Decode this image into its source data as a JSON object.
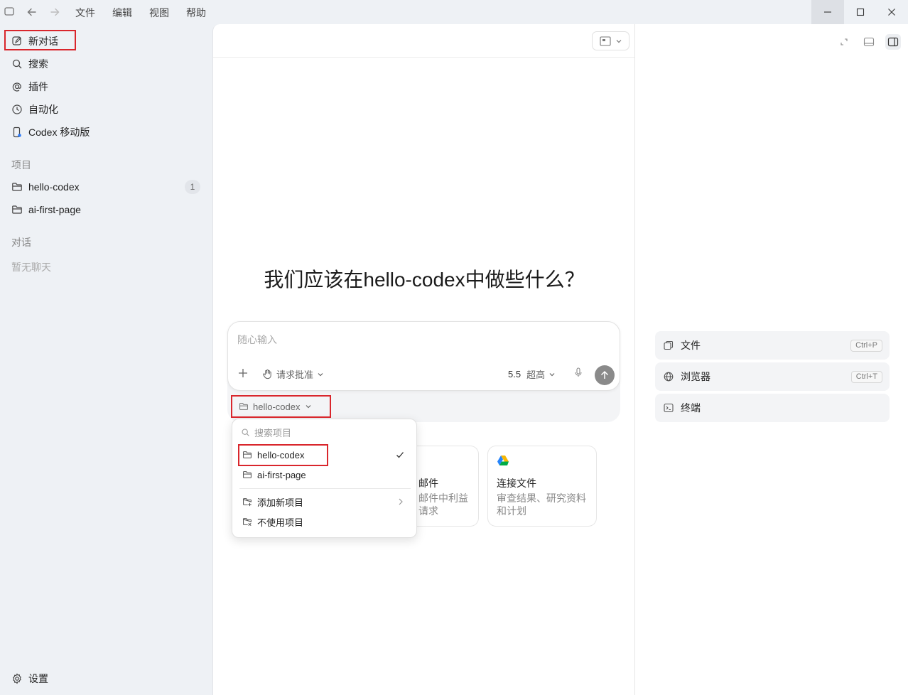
{
  "titlebar": {
    "menus": [
      "文件",
      "编辑",
      "视图",
      "帮助"
    ]
  },
  "sidebar": {
    "nav": [
      {
        "label": "新对话",
        "icon": "edit-icon"
      },
      {
        "label": "搜索",
        "icon": "search-icon"
      },
      {
        "label": "插件",
        "icon": "at-icon"
      },
      {
        "label": "自动化",
        "icon": "clock-icon"
      },
      {
        "label": "Codex 移动版",
        "icon": "mobile-icon"
      }
    ],
    "projects_label": "项目",
    "projects": [
      {
        "label": "hello-codex",
        "badge": "1"
      },
      {
        "label": "ai-first-page"
      }
    ],
    "chats_label": "对话",
    "chats_empty": "暂无聊天",
    "settings": "设置"
  },
  "main": {
    "headline": "我们应该在hello-codex中做些什么？",
    "composer": {
      "placeholder": "随心输入",
      "approval": "请求批准",
      "model": "5.5",
      "effort": "超高"
    },
    "project_chip": "hello-codex",
    "cards": [
      {
        "title": "邮件",
        "desc": "邮件中利益请求"
      },
      {
        "title": "连接文件",
        "desc": "审查结果、研究资料和计划"
      }
    ]
  },
  "dropdown": {
    "search_placeholder": "搜索项目",
    "items": [
      {
        "label": "hello-codex",
        "checked": true
      },
      {
        "label": "ai-first-page"
      }
    ],
    "add_new": "添加新项目",
    "no_project": "不使用项目"
  },
  "right_panel": {
    "items": [
      {
        "label": "文件",
        "shortcut": "Ctrl+P",
        "icon": "files-icon"
      },
      {
        "label": "浏览器",
        "shortcut": "Ctrl+T",
        "icon": "globe-icon"
      },
      {
        "label": "终端",
        "icon": "terminal-icon"
      }
    ]
  },
  "colors": {
    "highlight": "#d9262c",
    "sidebar_bg": "#eef1f5",
    "send_button": "#8a8a8a"
  }
}
